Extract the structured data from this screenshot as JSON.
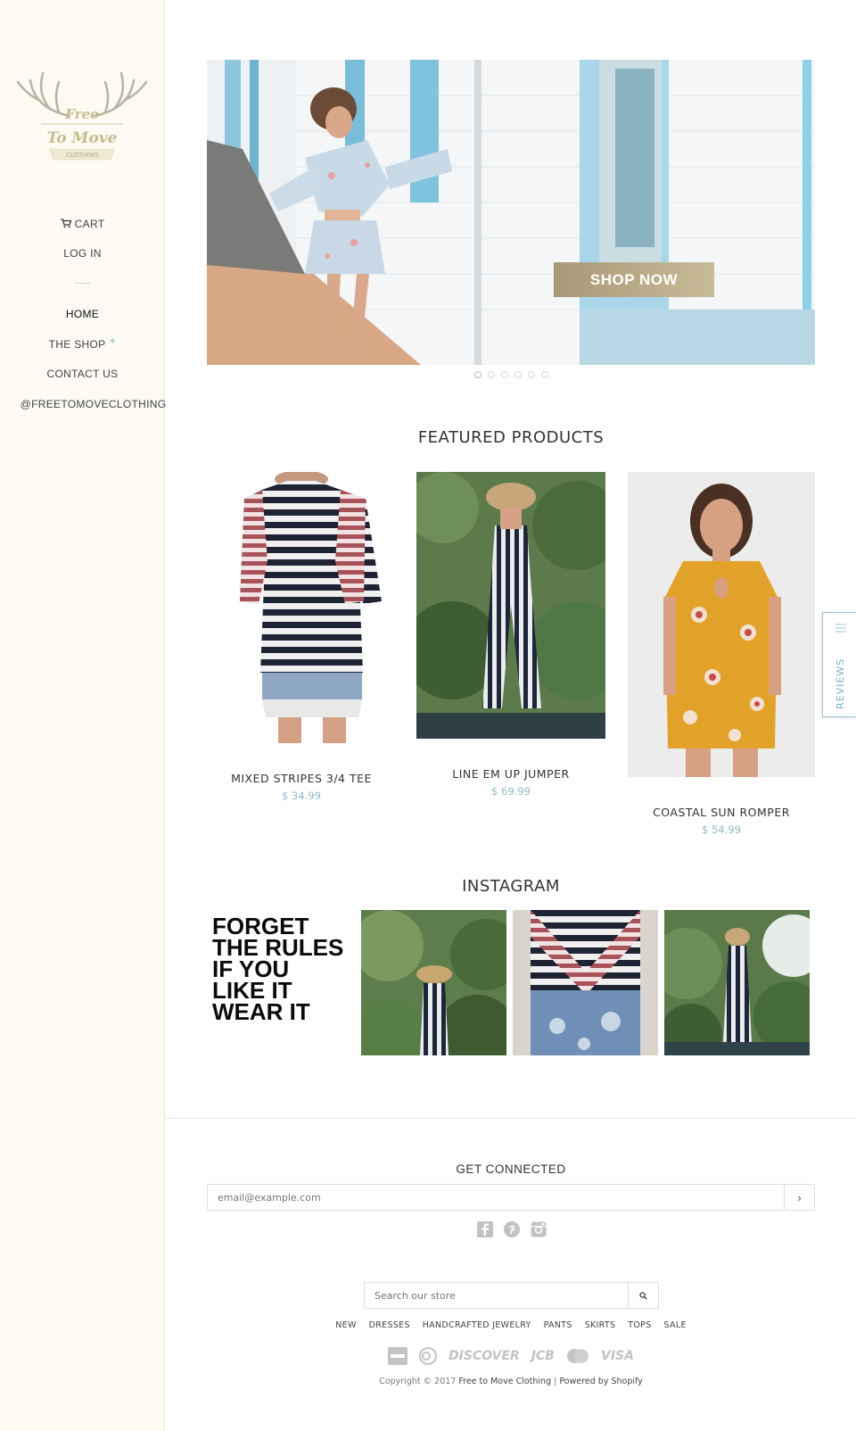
{
  "sidebar": {
    "logo_line1": "Free",
    "logo_line2": "To Move",
    "logo_line3": "CLOTHING",
    "cart_label": "CART",
    "login_label": "LOG IN",
    "nav": [
      {
        "label": "HOME"
      },
      {
        "label": "THE SHOP",
        "plus": "+"
      },
      {
        "label": "CONTACT US"
      },
      {
        "label": "@FREETOMOVECLOTHING"
      }
    ]
  },
  "hero": {
    "button_label": "SHOP NOW",
    "slide_count": 6,
    "active_slide": 1
  },
  "featured": {
    "title": "FEATURED PRODUCTS",
    "products": [
      {
        "name": "MIXED STRIPES 3/4 TEE",
        "price": "$ 34.99"
      },
      {
        "name": "LINE EM UP JUMPER",
        "price": "$ 69.99"
      },
      {
        "name": "COASTAL SUN ROMPER",
        "price": "$ 54.99"
      }
    ]
  },
  "instagram": {
    "title": "INSTAGRAM",
    "quote": [
      "FORGET",
      "THE RULES",
      "IF YOU",
      "LIKE IT",
      "WEAR IT"
    ]
  },
  "reviews_tab": {
    "label": "REVIEWS"
  },
  "footer": {
    "connect_title": "GET CONNECTED",
    "email_placeholder": "email@example.com",
    "email_button": "›",
    "search_placeholder": "Search our store",
    "nav": [
      "NEW",
      "DRESSES",
      "HANDCRAFTED JEWELRY",
      "PANTS",
      "SKIRTS",
      "TOPS",
      "SALE"
    ],
    "payments": [
      "AMEX",
      "DISCOVER",
      "JCB",
      "MasterCard",
      "VISA"
    ],
    "copyright_prefix": "Copyright © 2017",
    "store_name": "Free to Move Clothing",
    "separator": "|",
    "powered": "Powered by Shopify"
  },
  "colors": {
    "sidebar_bg": "#fcfaf3",
    "accent_price": "#8fbcc6",
    "shop_now_btn": "#b3a682"
  }
}
